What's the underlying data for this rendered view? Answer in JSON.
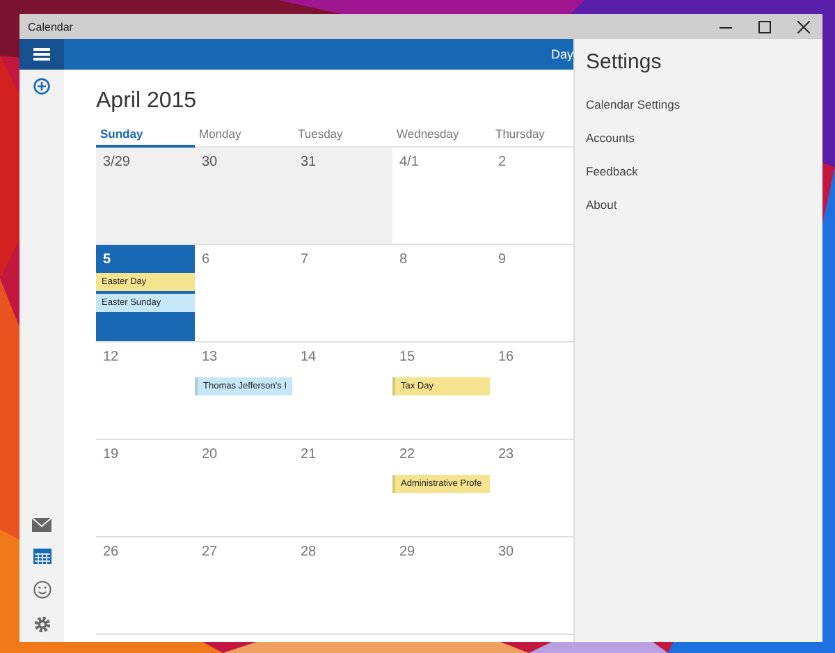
{
  "window": {
    "title": "Calendar"
  },
  "toolbar": {
    "view_label": "Day"
  },
  "month_title": "April 2015",
  "weekdays": [
    {
      "label": "Sunday",
      "selected": true
    },
    {
      "label": "Monday",
      "selected": false
    },
    {
      "label": "Tuesday",
      "selected": false
    },
    {
      "label": "Wednesday",
      "selected": false
    },
    {
      "label": "Thursday",
      "selected": false
    }
  ],
  "weeks": [
    {
      "days": [
        {
          "date": "3/29",
          "other_month": true,
          "today": false
        },
        {
          "date": "30",
          "other_month": true,
          "today": false
        },
        {
          "date": "31",
          "other_month": true,
          "today": false
        },
        {
          "date": "4/1",
          "other_month": false,
          "today": false
        },
        {
          "date": "2",
          "other_month": false,
          "today": false
        }
      ]
    },
    {
      "days": [
        {
          "date": "5",
          "other_month": false,
          "today": true,
          "events": [
            {
              "title": "Easter Day",
              "color": "#f5e38f"
            },
            {
              "title": "Easter Sunday",
              "color": "#c6e7f8"
            }
          ]
        },
        {
          "date": "6",
          "other_month": false,
          "today": false
        },
        {
          "date": "7",
          "other_month": false,
          "today": false
        },
        {
          "date": "8",
          "other_month": false,
          "today": false
        },
        {
          "date": "9",
          "other_month": false,
          "today": false
        }
      ]
    },
    {
      "days": [
        {
          "date": "12",
          "other_month": false,
          "today": false
        },
        {
          "date": "13",
          "other_month": false,
          "today": false,
          "events": [
            {
              "title": "Thomas Jefferson's I",
              "color": "#c6e7f8"
            }
          ]
        },
        {
          "date": "14",
          "other_month": false,
          "today": false
        },
        {
          "date": "15",
          "other_month": false,
          "today": false,
          "events": [
            {
              "title": "Tax Day",
              "color": "#f5e38f"
            }
          ]
        },
        {
          "date": "16",
          "other_month": false,
          "today": false
        }
      ]
    },
    {
      "days": [
        {
          "date": "19",
          "other_month": false,
          "today": false
        },
        {
          "date": "20",
          "other_month": false,
          "today": false
        },
        {
          "date": "21",
          "other_month": false,
          "today": false
        },
        {
          "date": "22",
          "other_month": false,
          "today": false,
          "events": [
            {
              "title": "Administrative Profe",
              "color": "#f5e38f"
            }
          ]
        },
        {
          "date": "23",
          "other_month": false,
          "today": false
        }
      ]
    },
    {
      "days": [
        {
          "date": "26",
          "other_month": false,
          "today": false
        },
        {
          "date": "27",
          "other_month": false,
          "today": false
        },
        {
          "date": "28",
          "other_month": false,
          "today": false
        },
        {
          "date": "29",
          "other_month": false,
          "today": false
        },
        {
          "date": "30",
          "other_month": false,
          "today": false
        }
      ]
    }
  ],
  "settings": {
    "title": "Settings",
    "items": [
      "Calendar Settings",
      "Accounts",
      "Feedback",
      "About"
    ]
  }
}
